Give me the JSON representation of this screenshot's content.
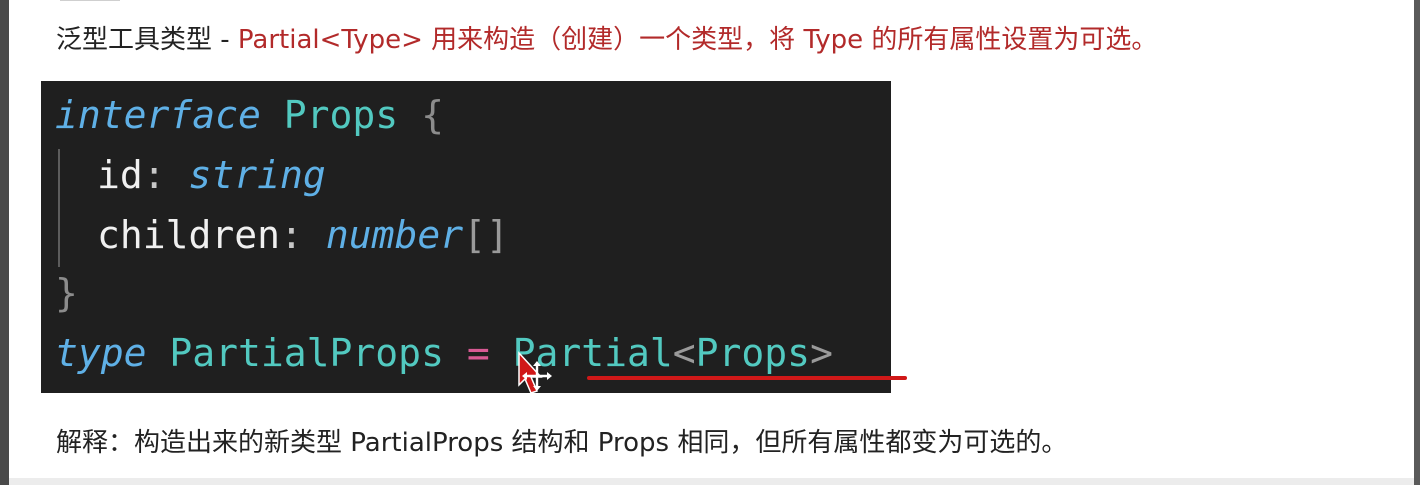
{
  "heading": {
    "prefix": "泛型工具类型 - ",
    "highlight": "Partial<Type> 用来构造（创建）一个类型，将 Type 的所有属性设置为可选。"
  },
  "code": {
    "line1": {
      "kw": "interface",
      "name": "Props",
      "brace": "{"
    },
    "line2": {
      "prop": "id",
      "colon": ":",
      "type": "string"
    },
    "line3": {
      "prop": "children",
      "colon": ":",
      "type": "number",
      "brackets": "[]"
    },
    "line4": {
      "brace": "}"
    },
    "line5": {
      "kw": "type",
      "name": "PartialProps",
      "op": "=",
      "generic": "Partial",
      "lt": "<",
      "arg": "Props",
      "gt": ">"
    }
  },
  "explanation": "解释：构造出来的新类型 PartialProps 结构和 Props 相同，但所有属性都变为可选的。",
  "icons": {
    "cursor": "move-cursor-icon"
  },
  "colors": {
    "highlight": "#b22a2a",
    "code_bg": "#1f1f1f",
    "keyword": "#5fb0e6",
    "type_name": "#52c9c0",
    "operator": "#d85a94",
    "annotation_underline": "#d01818"
  }
}
